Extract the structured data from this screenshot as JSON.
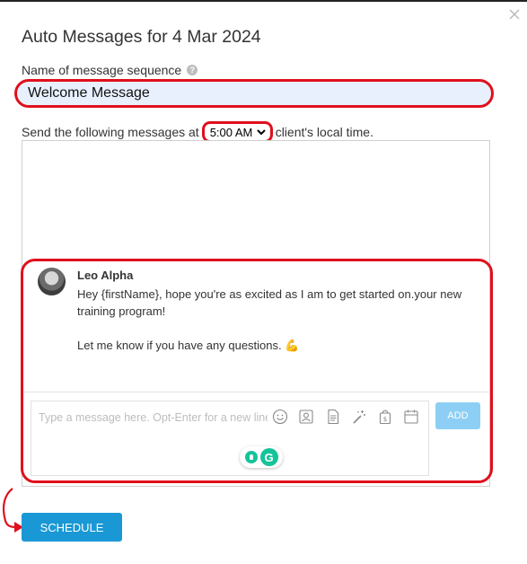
{
  "dialog": {
    "title": "Auto Messages for 4 Mar 2024"
  },
  "sequence_name": {
    "label": "Name of message sequence",
    "help_icon": "question-mark-icon",
    "value": "Welcome Message"
  },
  "send_time": {
    "prefix": "Send the following messages at",
    "selected": "5:00 AM",
    "suffix": "client's local time."
  },
  "message": {
    "sender": "Leo Alpha",
    "line1": "Hey {firstName}, hope you're as excited as I am to get started on.your new training program!",
    "line2": "Let me know if you have any questions. 💪"
  },
  "composer": {
    "placeholder": "Type a message here. Opt-Enter for a new line.",
    "tools": [
      "emoji-icon",
      "contact-card-icon",
      "document-icon",
      "magic-wand-icon",
      "payment-bag-icon",
      "calendar-icon"
    ],
    "add_label": "ADD"
  },
  "actions": {
    "schedule_label": "SCHEDULE"
  },
  "colors": {
    "highlight": "#e0101c",
    "primary": "#1a98d5",
    "add_disabled": "#8dcff4",
    "input_bg": "#e8f0fe"
  }
}
